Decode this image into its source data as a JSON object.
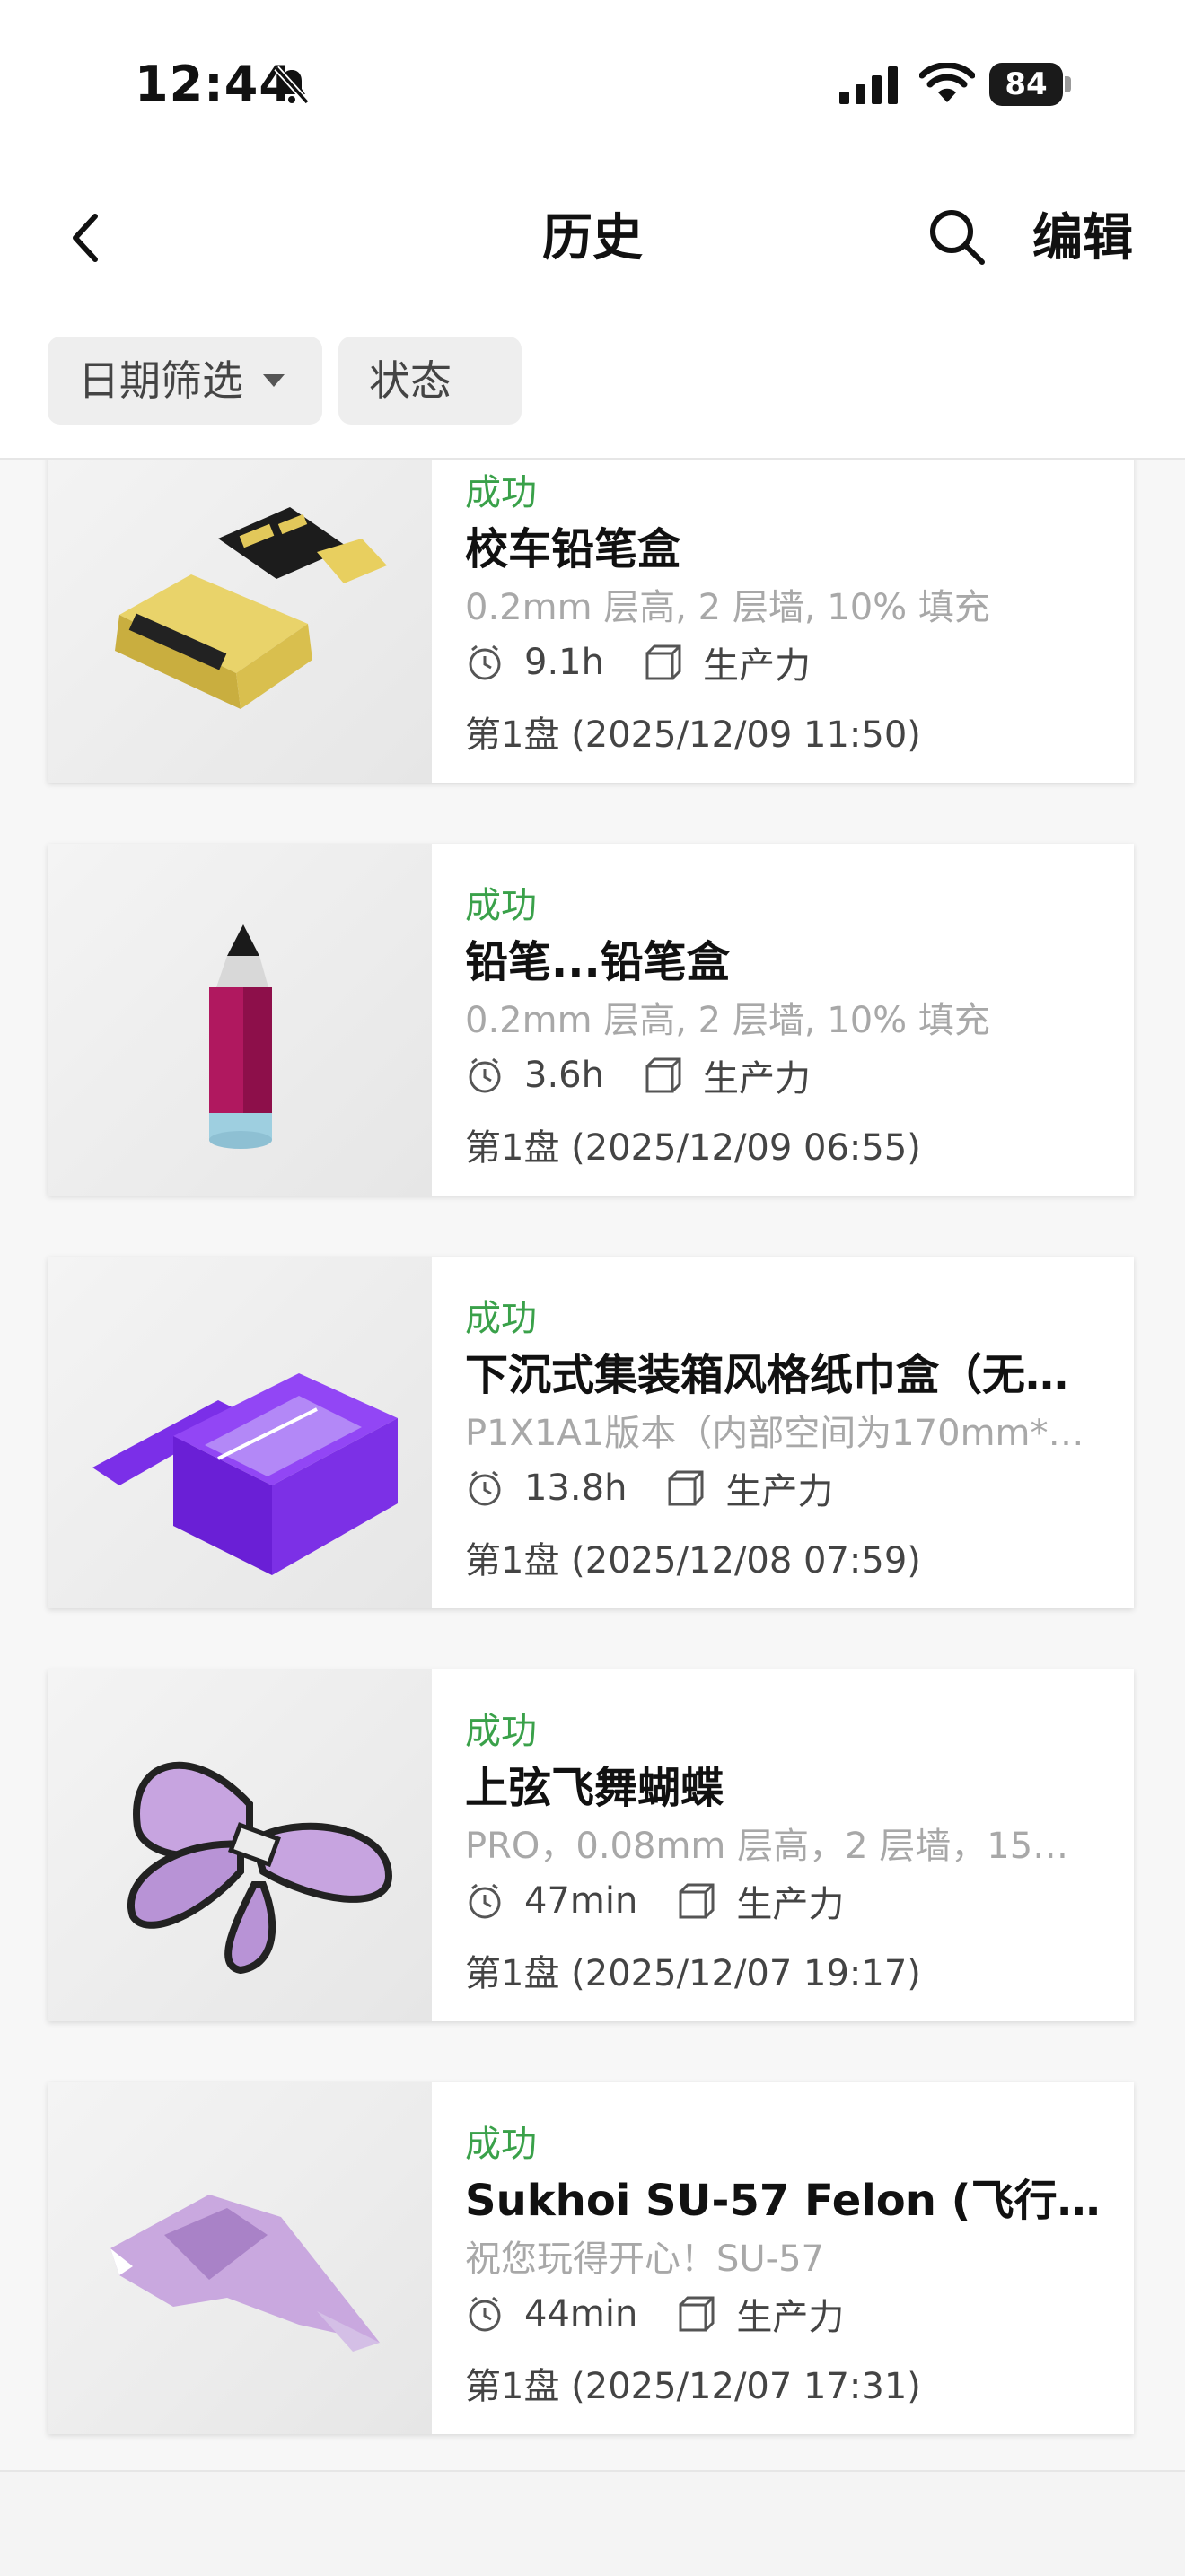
{
  "status_bar": {
    "time": "12:44",
    "battery": "84"
  },
  "nav": {
    "title": "历史",
    "edit_label": "编辑"
  },
  "filters": {
    "date_label": "日期筛选",
    "status_label": "状态"
  },
  "tasks": [
    {
      "status": "成功",
      "title": "校车铅笔盒",
      "desc": "0.2mm 层高, 2 层墙, 10% 填充",
      "duration": "9.1h",
      "printer": "生产力",
      "plate": "第1盘 (2025/12/09 11:50)"
    },
    {
      "status": "成功",
      "title": "铅笔...铅笔盒",
      "desc": "0.2mm 层高, 2 层墙, 10% 填充",
      "duration": "3.6h",
      "printer": "生产力",
      "plate": "第1盘 (2025/12/09 06:55)"
    },
    {
      "status": "成功",
      "title": "下沉式集装箱风格纸巾盒（无…",
      "desc": "P1X1A1版本（内部空间为170mm*…",
      "duration": "13.8h",
      "printer": "生产力",
      "plate": "第1盘 (2025/12/08 07:59)"
    },
    {
      "status": "成功",
      "title": "上弦飞舞蝴蝶",
      "desc": "PRO，0.08mm 层高，2 层墙，15…",
      "duration": "47min",
      "printer": "生产力",
      "plate": "第1盘 (2025/12/07 19:17)"
    },
    {
      "status": "成功",
      "title": "Sukhoi SU-57 Felon (飞行…",
      "desc": "祝您玩得开心！SU-57",
      "duration": "44min",
      "printer": "生产力",
      "plate": "第1盘 (2025/12/07 17:31)"
    }
  ],
  "icons": {
    "back": "chevron-left-icon",
    "search": "search-icon",
    "clock": "clock-icon",
    "printer": "printer-box-icon"
  },
  "colors": {
    "success": "#3aa14a"
  }
}
